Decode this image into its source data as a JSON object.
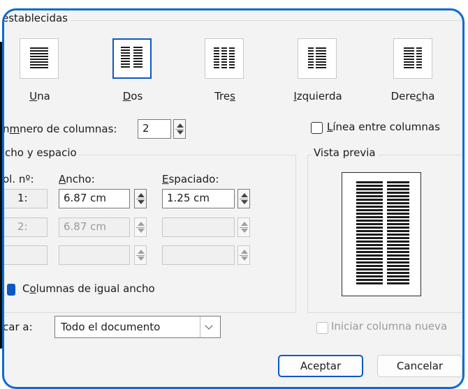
{
  "presets_group_label": "establecidas",
  "presets": [
    {
      "label_before": "",
      "accel": "U",
      "label_after": "na",
      "selected": false,
      "columns": 1
    },
    {
      "label_before": "",
      "accel": "D",
      "label_after": "os",
      "selected": true,
      "columns": 2
    },
    {
      "label_before": "Tre",
      "accel": "s",
      "label_after": "",
      "selected": false,
      "columns": 3
    },
    {
      "label_before": "",
      "accel": "I",
      "label_after": "zquierda",
      "selected": false,
      "columns": "left"
    },
    {
      "label_before": "Dere",
      "accel": "c",
      "label_after": "ha",
      "selected": false,
      "columns": "right"
    }
  ],
  "num_columns": {
    "label_before": "",
    "accel": "",
    "label_after": "nero de columnas:",
    "accel_mid": "m",
    "value": "2"
  },
  "line_between": {
    "label": "ínea entre columnas",
    "accel": "L",
    "checked": false
  },
  "width_spacing_group": {
    "label": "cho y espacio"
  },
  "table_headers": {
    "col": "ol. nº:",
    "width_accel": "A",
    "width_rest": "ncho:",
    "spacing_accel": "E",
    "spacing_rest": "spaciado:"
  },
  "rows": [
    {
      "num": "1:",
      "width": "6.87 cm",
      "spacing": "1.25 cm",
      "disabled": false
    },
    {
      "num": "2:",
      "width": "6.87 cm",
      "spacing": "",
      "disabled": true
    },
    {
      "num": "",
      "width": "",
      "spacing": "",
      "disabled": true
    }
  ],
  "equal_width": {
    "label_before": "C",
    "accel": "o",
    "label_after": "lumnas de igual ancho",
    "checked": true
  },
  "preview": {
    "label": "Vista previa"
  },
  "apply_to": {
    "label": "car a:",
    "value": "Todo el documento"
  },
  "start_new_column": {
    "label": "Iniciar columna nueva",
    "checked": false,
    "disabled": true
  },
  "buttons": {
    "ok": "Aceptar",
    "cancel": "Cancelar"
  },
  "colors": {
    "accent": "#0a6bd1",
    "selected_border": "#0a58c7",
    "dialog_bg": "#f3f3f3"
  }
}
